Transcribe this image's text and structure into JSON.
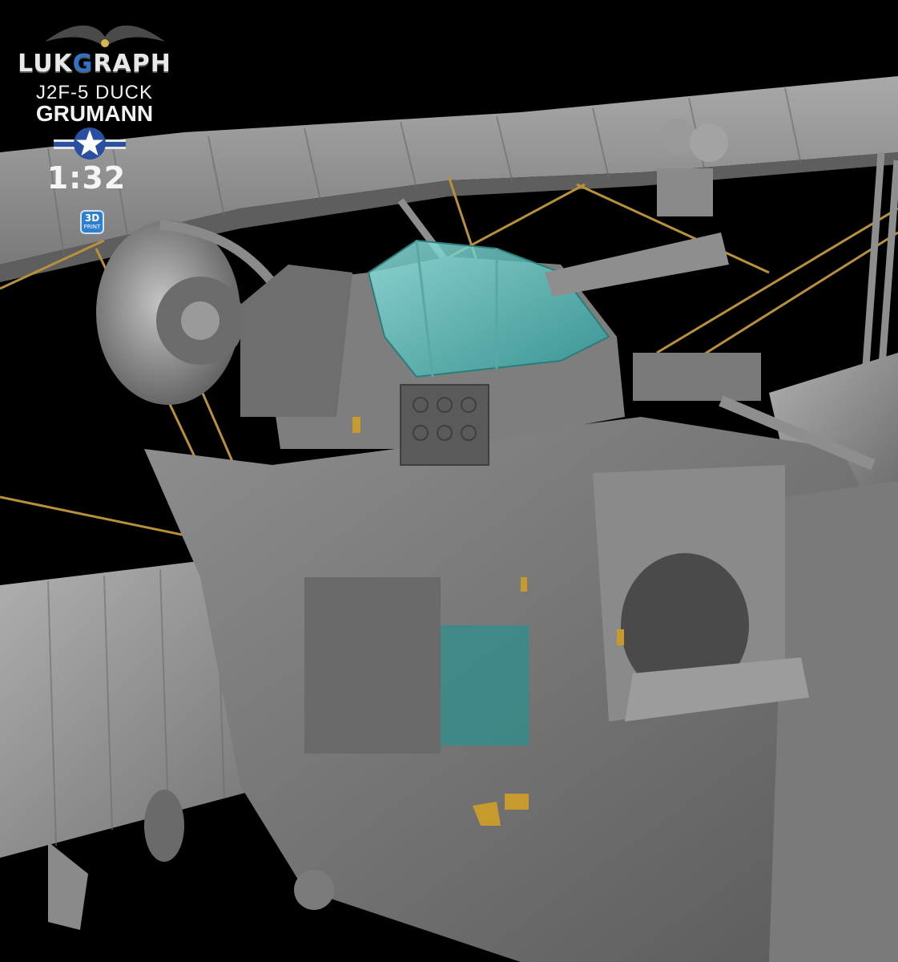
{
  "branding": {
    "logo_text_pre": "LUK",
    "logo_text_g": "G",
    "logo_text_post": "RAPH",
    "model": "J2F-5 DUCK",
    "manufacturer": "GRUMANN",
    "scale": "1:32",
    "print_badge_main": "3D",
    "print_badge_sub": "PRINT"
  },
  "colors": {
    "background": "#000000",
    "model_grey": "#8c8c8c",
    "canopy_teal": "#3fb7b5",
    "rigging_gold": "#b8913a",
    "logo_blue": "#2f74c8"
  }
}
